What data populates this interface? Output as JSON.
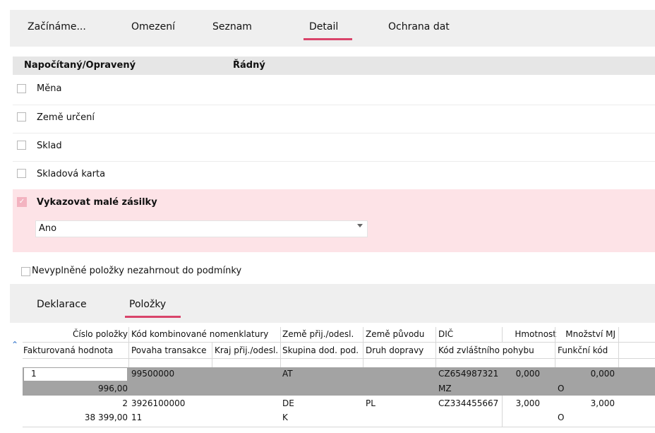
{
  "top_tabs": [
    {
      "label": "Začínáme..."
    },
    {
      "label": "Omezení"
    },
    {
      "label": "Seznam"
    },
    {
      "label": "Detail"
    },
    {
      "label": "Ochrana dat"
    }
  ],
  "active_top_tab": "Detail",
  "header": {
    "col1": "Napočítaný/Opravený",
    "col2": "Řádný"
  },
  "conditions": [
    {
      "label": "Měna"
    },
    {
      "label": "Země určení"
    },
    {
      "label": "Sklad"
    },
    {
      "label": "Skladová karta"
    }
  ],
  "small_shipments": {
    "label": "Vykazovat malé zásilky",
    "checked": true,
    "value": "Ano"
  },
  "exclude_empty": {
    "label": "Nevyplněné položky nezahrnout do podmínky",
    "checked": false
  },
  "sub_tabs": [
    {
      "label": "Deklarace"
    },
    {
      "label": "Položky"
    }
  ],
  "active_sub_tab": "Položky",
  "grid": {
    "header_row1": [
      "Číslo položky",
      "Kód kombinované nomenklatury",
      "Země přij./odesl.",
      "Země původu",
      "DIČ",
      "Hmotnost",
      "Množství MJ"
    ],
    "header_row2": [
      "Fakturovaná hodnota",
      "Povaha transakce",
      "Kraj přij./odesl.",
      "Skupina dod. pod.",
      "Druh dopravy",
      "Kód zvláštního pohybu",
      "Funkční kód"
    ],
    "rows": [
      {
        "line1": [
          "1",
          "99500000",
          "AT",
          "",
          "CZ654987321",
          "0,000",
          "0,000"
        ],
        "line2": [
          "996,00",
          "",
          "",
          "",
          "",
          "MZ",
          "O"
        ]
      },
      {
        "line1": [
          "2",
          "3926100000",
          "DE",
          "PL",
          "CZ334455667",
          "3,000",
          "3,000"
        ],
        "line2": [
          "38 399,00",
          "11",
          "",
          "K",
          "",
          "",
          "O"
        ]
      }
    ]
  },
  "colors": {
    "accent": "#d9446a",
    "selected_row": "#a3a3a3",
    "highlight_bg": "#fde3e7",
    "link_icon": "#2a6fc9"
  },
  "icons": {
    "expand": "double-chevron-up-icon"
  }
}
